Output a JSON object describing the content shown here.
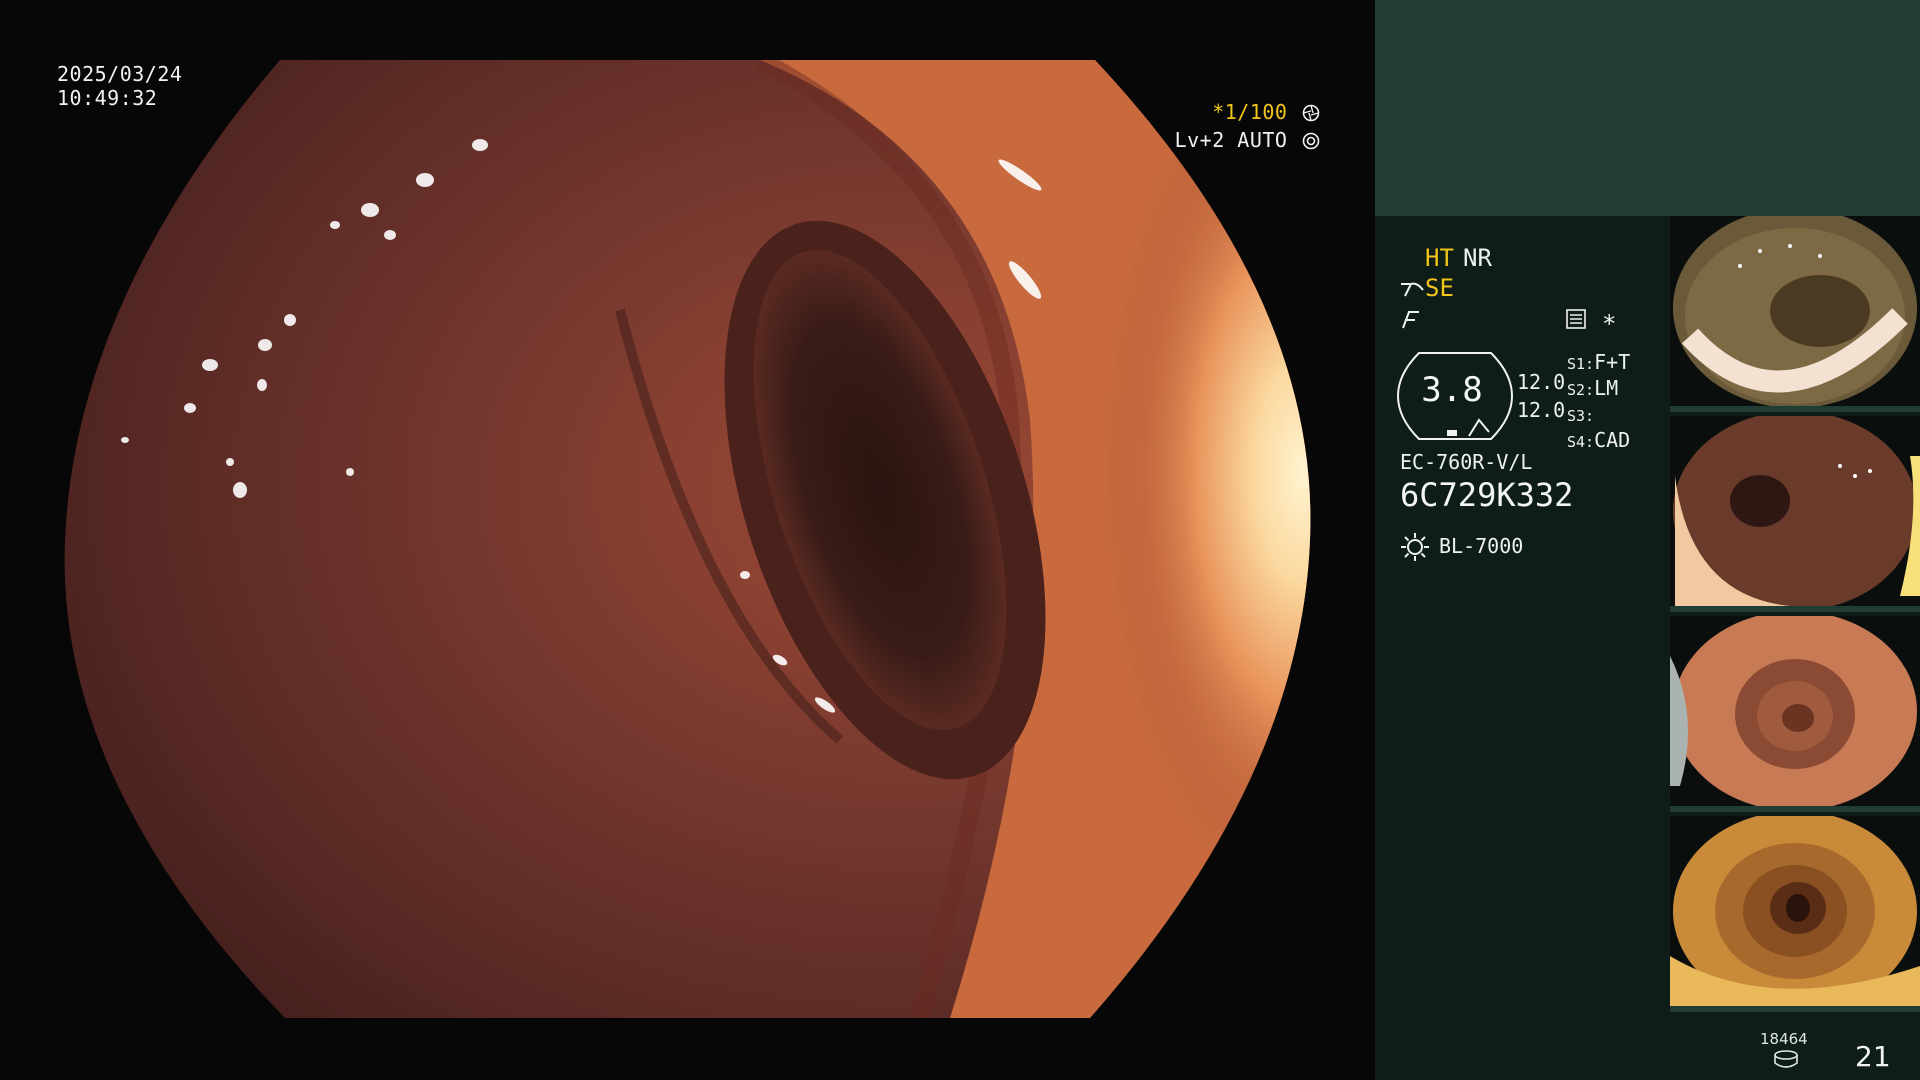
{
  "app": {
    "timestamp": {
      "date": "2025/03/24",
      "time": "10:49:32"
    },
    "video_osd": {
      "shutter": "*1/100",
      "level": "Lv+2 AUTO"
    }
  },
  "side_panel": {
    "modes": {
      "ht": "HT",
      "nr": "NR",
      "se": "SE",
      "star": "*"
    },
    "gauge": {
      "value": "3.8",
      "right_top": "12.0",
      "right_bottom": "12.0"
    },
    "settings": [
      {
        "key": "S1:",
        "value": "F+T"
      },
      {
        "key": "S2:",
        "value": "LM"
      },
      {
        "key": "S3:",
        "value": ""
      },
      {
        "key": "S4:",
        "value": "CAD"
      }
    ],
    "scope": {
      "model": "EC-760R-V/L",
      "serial": "6C729K332"
    },
    "light_source": "BL-7000",
    "capture": {
      "count_label": "18464",
      "number": "21"
    }
  },
  "colors": {
    "panel_bg": "#0f1d19",
    "panel_header": "#223b33",
    "accent_yellow": "#f3c61b",
    "text": "#eef2ee"
  }
}
